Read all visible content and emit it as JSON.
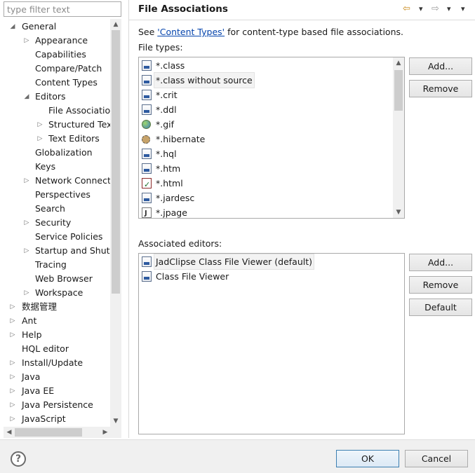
{
  "filter": {
    "placeholder": "type filter text"
  },
  "tree": [
    {
      "label": "General",
      "depth": 0,
      "twisty": "expanded"
    },
    {
      "label": "Appearance",
      "depth": 1,
      "twisty": "collapsed"
    },
    {
      "label": "Capabilities",
      "depth": 1,
      "twisty": "none"
    },
    {
      "label": "Compare/Patch",
      "depth": 1,
      "twisty": "none"
    },
    {
      "label": "Content Types",
      "depth": 1,
      "twisty": "none"
    },
    {
      "label": "Editors",
      "depth": 1,
      "twisty": "expanded"
    },
    {
      "label": "File Associations",
      "depth": 2,
      "twisty": "none",
      "selected": true
    },
    {
      "label": "Structured Text Editors",
      "depth": 2,
      "twisty": "collapsed"
    },
    {
      "label": "Text Editors",
      "depth": 2,
      "twisty": "collapsed"
    },
    {
      "label": "Globalization",
      "depth": 1,
      "twisty": "none"
    },
    {
      "label": "Keys",
      "depth": 1,
      "twisty": "none"
    },
    {
      "label": "Network Connections",
      "depth": 1,
      "twisty": "collapsed"
    },
    {
      "label": "Perspectives",
      "depth": 1,
      "twisty": "none"
    },
    {
      "label": "Search",
      "depth": 1,
      "twisty": "none"
    },
    {
      "label": "Security",
      "depth": 1,
      "twisty": "collapsed"
    },
    {
      "label": "Service Policies",
      "depth": 1,
      "twisty": "none"
    },
    {
      "label": "Startup and Shutdown",
      "depth": 1,
      "twisty": "collapsed"
    },
    {
      "label": "Tracing",
      "depth": 1,
      "twisty": "none"
    },
    {
      "label": "Web Browser",
      "depth": 1,
      "twisty": "none"
    },
    {
      "label": "Workspace",
      "depth": 1,
      "twisty": "collapsed"
    },
    {
      "label": "数据管理",
      "depth": 0,
      "twisty": "collapsed"
    },
    {
      "label": "Ant",
      "depth": 0,
      "twisty": "collapsed"
    },
    {
      "label": "Help",
      "depth": 0,
      "twisty": "collapsed"
    },
    {
      "label": "HQL editor",
      "depth": 0,
      "twisty": "none"
    },
    {
      "label": "Install/Update",
      "depth": 0,
      "twisty": "collapsed"
    },
    {
      "label": "Java",
      "depth": 0,
      "twisty": "collapsed"
    },
    {
      "label": "Java EE",
      "depth": 0,
      "twisty": "collapsed"
    },
    {
      "label": "Java Persistence",
      "depth": 0,
      "twisty": "collapsed"
    },
    {
      "label": "JavaScript",
      "depth": 0,
      "twisty": "collapsed"
    }
  ],
  "page": {
    "title": "File Associations",
    "see_prefix": "See ",
    "see_link": "'Content Types'",
    "see_suffix": " for content-type based file associations.",
    "file_types_label": "File types:",
    "associated_editors_label": "Associated editors:"
  },
  "file_types": [
    {
      "label": "*.class",
      "icon": "class-file-icon"
    },
    {
      "label": "*.class without source",
      "icon": "class-file-icon",
      "highlighted": true
    },
    {
      "label": "*.crit",
      "icon": "crit-file-icon"
    },
    {
      "label": "*.ddl",
      "icon": "ddl-file-icon"
    },
    {
      "label": "*.gif",
      "icon": "image-globe-icon"
    },
    {
      "label": "*.hibernate",
      "icon": "hibernate-icon"
    },
    {
      "label": "*.hql",
      "icon": "hql-file-icon"
    },
    {
      "label": "*.htm",
      "icon": "htm-file-icon"
    },
    {
      "label": "*.html",
      "icon": "html-file-icon"
    },
    {
      "label": "*.jardesc",
      "icon": "jardesc-file-icon"
    },
    {
      "label": "*.jpage",
      "icon": "jpage-file-icon"
    }
  ],
  "editors": [
    {
      "label": "JadClipse Class File Viewer (default)",
      "icon": "class-viewer-icon",
      "highlighted": true
    },
    {
      "label": "Class File Viewer",
      "icon": "class-viewer-icon"
    }
  ],
  "buttons": {
    "add": "Add...",
    "remove": "Remove",
    "default": "Default",
    "ok": "OK",
    "cancel": "Cancel"
  },
  "nav": {
    "back_glyph": "⇦",
    "forward_glyph": "⇨",
    "dropdown_glyph": "▾",
    "menu_glyph": "▾"
  },
  "help_glyph": "?"
}
